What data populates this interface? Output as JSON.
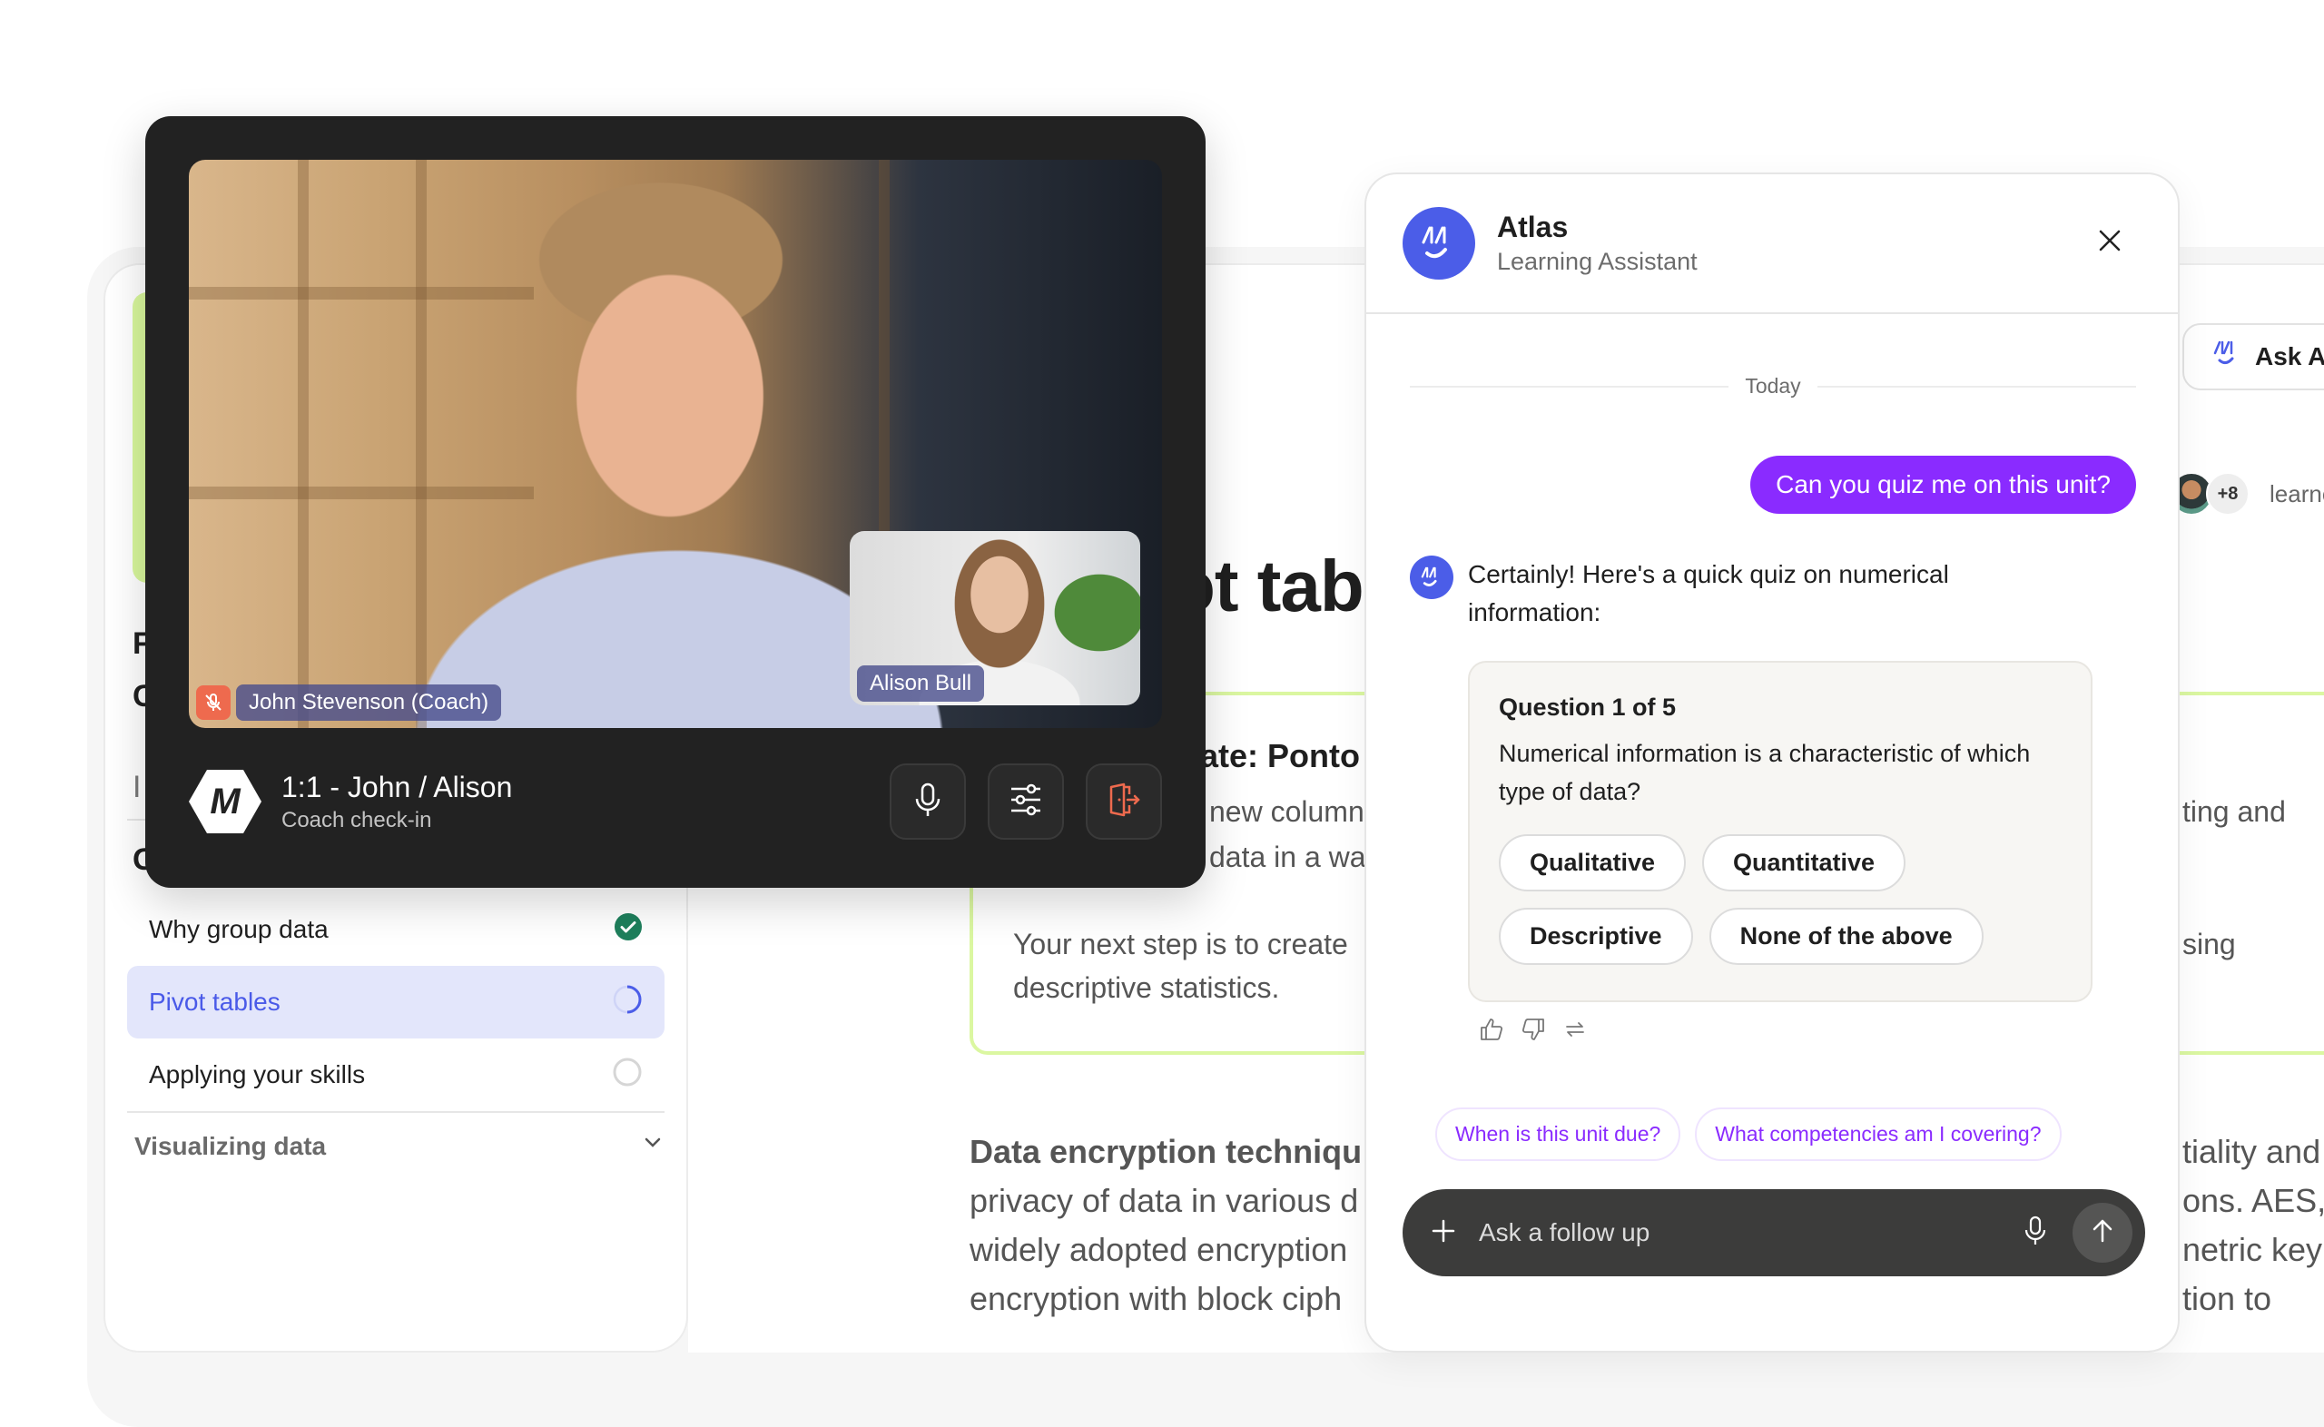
{
  "background": {
    "sidebar": {
      "partial_heading_letters": [
        "F",
        "C"
      ],
      "partial_items": [
        "I",
        "G"
      ],
      "lessons": [
        {
          "label": "Why group data",
          "status": "completed"
        },
        {
          "label": "Pivot tables",
          "status": "in-progress",
          "active": true
        },
        {
          "label": "Applying your skills",
          "status": "not-started"
        }
      ],
      "section": {
        "label": "Visualizing data",
        "expanded": false
      }
    },
    "main": {
      "title_fragment": "ot tab",
      "card": {
        "heading_fragment": "date: Ponto",
        "lines": [
          "new column",
          "data in a wa"
        ],
        "next_step_lines": [
          "Your next step is to create",
          "descriptive statistics."
        ],
        "right_fragments": [
          "ting and",
          "sing"
        ]
      },
      "article": {
        "heading_fragment": "Data encryption techniqu",
        "lines": [
          "privacy of data in various d",
          "widely adopted encryption",
          "encryption with block ciph"
        ],
        "right_fragments": [
          "tiality and",
          "ons. AES,",
          "netric key",
          "tion to"
        ]
      },
      "ask_atlas_label": "Ask At",
      "learners": {
        "more_count": "+8",
        "label": "learne"
      }
    }
  },
  "video_call": {
    "main_participant": {
      "name": "John Stevenson (Coach)",
      "muted": true
    },
    "pip_participant": {
      "name": "Alison Bull"
    },
    "title": "1:1 - John / Alison",
    "subtitle": "Coach check-in",
    "brand_glyph": "M",
    "controls": [
      {
        "name": "microphone",
        "icon": "mic-icon"
      },
      {
        "name": "settings",
        "icon": "sliders-icon"
      },
      {
        "name": "leave",
        "icon": "leave-door-icon"
      }
    ]
  },
  "chat": {
    "assistant_name": "Atlas",
    "assistant_role": "Learning Assistant",
    "date_label": "Today",
    "user_message": "Can you quiz me on this unit?",
    "bot_message": "Certainly! Here's a quick quiz on numerical information:",
    "quiz": {
      "heading": "Question 1 of 5",
      "question": "Numerical information is a characteristic of which type of data?",
      "options": [
        "Qualitative",
        "Quantitative",
        "Descriptive",
        "None of the above"
      ]
    },
    "suggestions": [
      "When is this unit due?",
      "What competencies am I covering?"
    ],
    "composer": {
      "placeholder": "Ask a follow up",
      "value": ""
    }
  },
  "colors": {
    "accent_purple": "#8a2bff",
    "atlas_blue": "#4b5de8",
    "success_green": "#1e7f5c",
    "leave_red": "#ee6a4e",
    "lime": "#d8f79c"
  }
}
